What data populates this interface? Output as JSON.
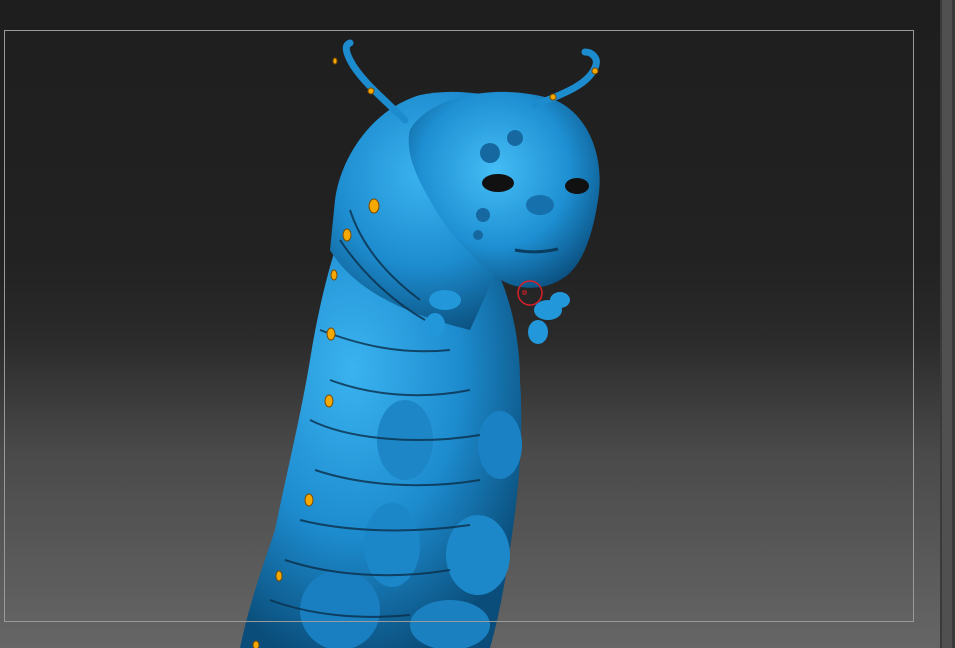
{
  "viewport": {
    "background_top": "#1e1e1e",
    "background_bottom": "#666666",
    "frame_color": "#9a9a9a"
  },
  "model": {
    "subject": "caterpillar-sculpt",
    "material_color": "#1f8fd1",
    "material_shadow": "#0b4f7c",
    "spot_color": "#f5a800"
  },
  "brush_cursor": {
    "color": "#d8202a"
  },
  "scrollbar": {
    "track_color": "#3a3a3a"
  }
}
